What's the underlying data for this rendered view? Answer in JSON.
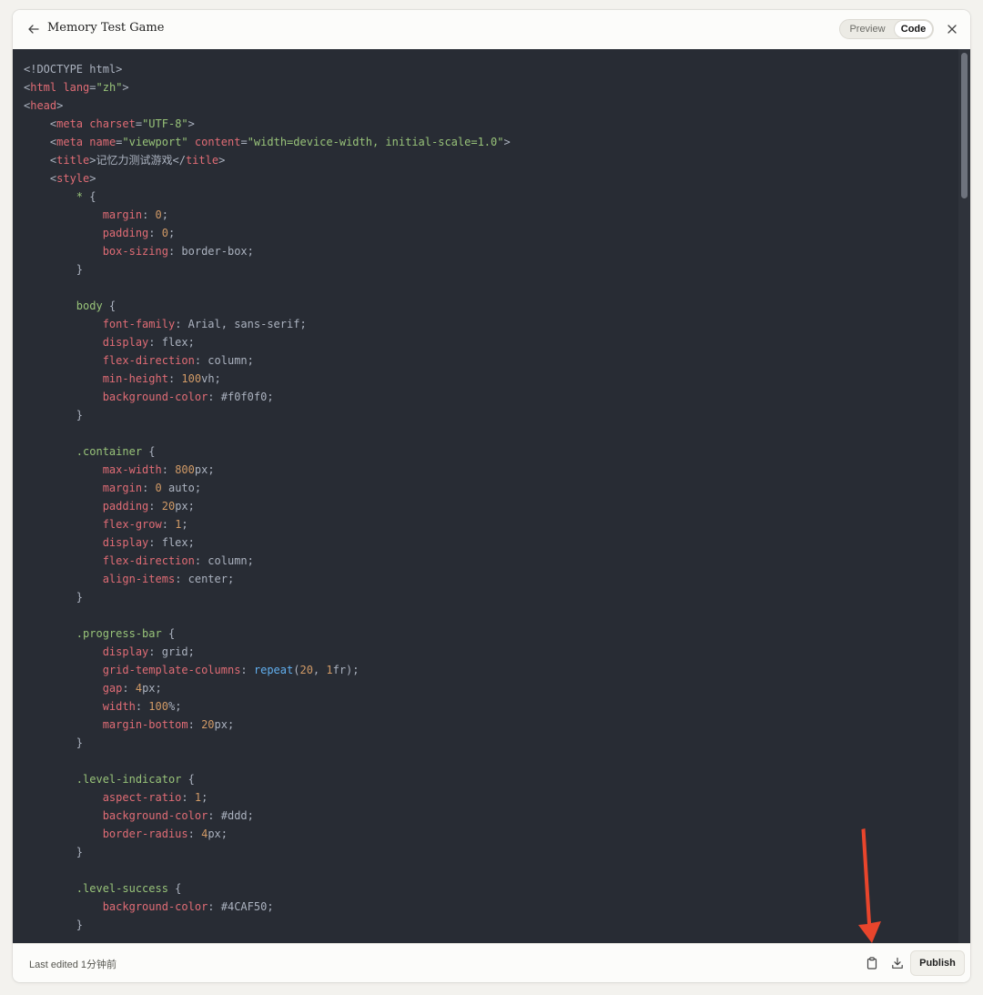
{
  "header": {
    "title": "Memory Test Game",
    "toggle": {
      "preview_label": "Preview",
      "code_label": "Code",
      "selected": "Code"
    }
  },
  "code": {
    "lines": [
      [
        [
          "t-txt",
          "<!DOCTYPE html>"
        ]
      ],
      [
        [
          "t-txt",
          "<"
        ],
        [
          "t-tag",
          "html"
        ],
        [
          "t-txt",
          " "
        ],
        [
          "t-attr",
          "lang"
        ],
        [
          "t-txt",
          "="
        ],
        [
          "t-str",
          "\"zh\""
        ],
        [
          "t-txt",
          ">"
        ]
      ],
      [
        [
          "t-txt",
          "<"
        ],
        [
          "t-tag",
          "head"
        ],
        [
          "t-txt",
          ">"
        ]
      ],
      [
        [
          "t-txt",
          "    <"
        ],
        [
          "t-tag",
          "meta"
        ],
        [
          "t-txt",
          " "
        ],
        [
          "t-attr",
          "charset"
        ],
        [
          "t-txt",
          "="
        ],
        [
          "t-str",
          "\"UTF-8\""
        ],
        [
          "t-txt",
          ">"
        ]
      ],
      [
        [
          "t-txt",
          "    <"
        ],
        [
          "t-tag",
          "meta"
        ],
        [
          "t-txt",
          " "
        ],
        [
          "t-attr",
          "name"
        ],
        [
          "t-txt",
          "="
        ],
        [
          "t-str",
          "\"viewport\""
        ],
        [
          "t-txt",
          " "
        ],
        [
          "t-attr",
          "content"
        ],
        [
          "t-txt",
          "="
        ],
        [
          "t-str",
          "\"width=device-width, initial-scale=1.0\""
        ],
        [
          "t-txt",
          ">"
        ]
      ],
      [
        [
          "t-txt",
          "    <"
        ],
        [
          "t-tag",
          "title"
        ],
        [
          "t-txt",
          ">记忆力测试游戏</"
        ],
        [
          "t-tag",
          "title"
        ],
        [
          "t-txt",
          ">"
        ]
      ],
      [
        [
          "t-txt",
          "    <"
        ],
        [
          "t-tag",
          "style"
        ],
        [
          "t-txt",
          ">"
        ]
      ],
      [
        [
          "t-txt",
          "        "
        ],
        [
          "t-sel",
          "*"
        ],
        [
          "t-txt",
          " {"
        ]
      ],
      [
        [
          "t-txt",
          "            "
        ],
        [
          "t-prop",
          "margin"
        ],
        [
          "t-txt",
          ": "
        ],
        [
          "t-num",
          "0"
        ],
        [
          "t-txt",
          ";"
        ]
      ],
      [
        [
          "t-txt",
          "            "
        ],
        [
          "t-prop",
          "padding"
        ],
        [
          "t-txt",
          ": "
        ],
        [
          "t-num",
          "0"
        ],
        [
          "t-txt",
          ";"
        ]
      ],
      [
        [
          "t-txt",
          "            "
        ],
        [
          "t-prop",
          "box-sizing"
        ],
        [
          "t-txt",
          ": border-box;"
        ]
      ],
      [
        [
          "t-txt",
          "        }"
        ]
      ],
      [
        [
          "t-txt",
          ""
        ]
      ],
      [
        [
          "t-txt",
          "        "
        ],
        [
          "t-sel",
          "body"
        ],
        [
          "t-txt",
          " {"
        ]
      ],
      [
        [
          "t-txt",
          "            "
        ],
        [
          "t-prop",
          "font-family"
        ],
        [
          "t-txt",
          ": Arial, sans-serif;"
        ]
      ],
      [
        [
          "t-txt",
          "            "
        ],
        [
          "t-prop",
          "display"
        ],
        [
          "t-txt",
          ": flex;"
        ]
      ],
      [
        [
          "t-txt",
          "            "
        ],
        [
          "t-prop",
          "flex-direction"
        ],
        [
          "t-txt",
          ": column;"
        ]
      ],
      [
        [
          "t-txt",
          "            "
        ],
        [
          "t-prop",
          "min-height"
        ],
        [
          "t-txt",
          ": "
        ],
        [
          "t-num",
          "100"
        ],
        [
          "t-txt",
          "vh;"
        ]
      ],
      [
        [
          "t-txt",
          "            "
        ],
        [
          "t-prop",
          "background-color"
        ],
        [
          "t-txt",
          ": #f0f0f0;"
        ]
      ],
      [
        [
          "t-txt",
          "        }"
        ]
      ],
      [
        [
          "t-txt",
          ""
        ]
      ],
      [
        [
          "t-txt",
          "        "
        ],
        [
          "t-sel",
          ".container"
        ],
        [
          "t-txt",
          " {"
        ]
      ],
      [
        [
          "t-txt",
          "            "
        ],
        [
          "t-prop",
          "max-width"
        ],
        [
          "t-txt",
          ": "
        ],
        [
          "t-num",
          "800"
        ],
        [
          "t-txt",
          "px;"
        ]
      ],
      [
        [
          "t-txt",
          "            "
        ],
        [
          "t-prop",
          "margin"
        ],
        [
          "t-txt",
          ": "
        ],
        [
          "t-num",
          "0"
        ],
        [
          "t-txt",
          " auto;"
        ]
      ],
      [
        [
          "t-txt",
          "            "
        ],
        [
          "t-prop",
          "padding"
        ],
        [
          "t-txt",
          ": "
        ],
        [
          "t-num",
          "20"
        ],
        [
          "t-txt",
          "px;"
        ]
      ],
      [
        [
          "t-txt",
          "            "
        ],
        [
          "t-prop",
          "flex-grow"
        ],
        [
          "t-txt",
          ": "
        ],
        [
          "t-num",
          "1"
        ],
        [
          "t-txt",
          ";"
        ]
      ],
      [
        [
          "t-txt",
          "            "
        ],
        [
          "t-prop",
          "display"
        ],
        [
          "t-txt",
          ": flex;"
        ]
      ],
      [
        [
          "t-txt",
          "            "
        ],
        [
          "t-prop",
          "flex-direction"
        ],
        [
          "t-txt",
          ": column;"
        ]
      ],
      [
        [
          "t-txt",
          "            "
        ],
        [
          "t-prop",
          "align-items"
        ],
        [
          "t-txt",
          ": center;"
        ]
      ],
      [
        [
          "t-txt",
          "        }"
        ]
      ],
      [
        [
          "t-txt",
          ""
        ]
      ],
      [
        [
          "t-txt",
          "        "
        ],
        [
          "t-sel",
          ".progress-bar"
        ],
        [
          "t-txt",
          " {"
        ]
      ],
      [
        [
          "t-txt",
          "            "
        ],
        [
          "t-prop",
          "display"
        ],
        [
          "t-txt",
          ": grid;"
        ]
      ],
      [
        [
          "t-txt",
          "            "
        ],
        [
          "t-prop",
          "grid-template-columns"
        ],
        [
          "t-txt",
          ": "
        ],
        [
          "t-fn",
          "repeat"
        ],
        [
          "t-txt",
          "("
        ],
        [
          "t-num",
          "20"
        ],
        [
          "t-txt",
          ", "
        ],
        [
          "t-num",
          "1"
        ],
        [
          "t-txt",
          "fr);"
        ]
      ],
      [
        [
          "t-txt",
          "            "
        ],
        [
          "t-prop",
          "gap"
        ],
        [
          "t-txt",
          ": "
        ],
        [
          "t-num",
          "4"
        ],
        [
          "t-txt",
          "px;"
        ]
      ],
      [
        [
          "t-txt",
          "            "
        ],
        [
          "t-prop",
          "width"
        ],
        [
          "t-txt",
          ": "
        ],
        [
          "t-num",
          "100"
        ],
        [
          "t-txt",
          "%;"
        ]
      ],
      [
        [
          "t-txt",
          "            "
        ],
        [
          "t-prop",
          "margin-bottom"
        ],
        [
          "t-txt",
          ": "
        ],
        [
          "t-num",
          "20"
        ],
        [
          "t-txt",
          "px;"
        ]
      ],
      [
        [
          "t-txt",
          "        }"
        ]
      ],
      [
        [
          "t-txt",
          ""
        ]
      ],
      [
        [
          "t-txt",
          "        "
        ],
        [
          "t-sel",
          ".level-indicator"
        ],
        [
          "t-txt",
          " {"
        ]
      ],
      [
        [
          "t-txt",
          "            "
        ],
        [
          "t-prop",
          "aspect-ratio"
        ],
        [
          "t-txt",
          ": "
        ],
        [
          "t-num",
          "1"
        ],
        [
          "t-txt",
          ";"
        ]
      ],
      [
        [
          "t-txt",
          "            "
        ],
        [
          "t-prop",
          "background-color"
        ],
        [
          "t-txt",
          ": #ddd;"
        ]
      ],
      [
        [
          "t-txt",
          "            "
        ],
        [
          "t-prop",
          "border-radius"
        ],
        [
          "t-txt",
          ": "
        ],
        [
          "t-num",
          "4"
        ],
        [
          "t-txt",
          "px;"
        ]
      ],
      [
        [
          "t-txt",
          "        }"
        ]
      ],
      [
        [
          "t-txt",
          ""
        ]
      ],
      [
        [
          "t-txt",
          "        "
        ],
        [
          "t-sel",
          ".level-success"
        ],
        [
          "t-txt",
          " {"
        ]
      ],
      [
        [
          "t-txt",
          "            "
        ],
        [
          "t-prop",
          "background-color"
        ],
        [
          "t-txt",
          ": #4CAF50;"
        ]
      ],
      [
        [
          "t-txt",
          "        }"
        ]
      ]
    ]
  },
  "footer": {
    "last_edited": "Last edited 1分钟前",
    "publish_label": "Publish"
  },
  "icons": {
    "back": "arrow-left-icon",
    "close": "close-icon",
    "copy": "clipboard-icon",
    "download": "download-icon"
  },
  "colors": {
    "code_background": "#282c34",
    "annotation_arrow": "#e8452c"
  }
}
